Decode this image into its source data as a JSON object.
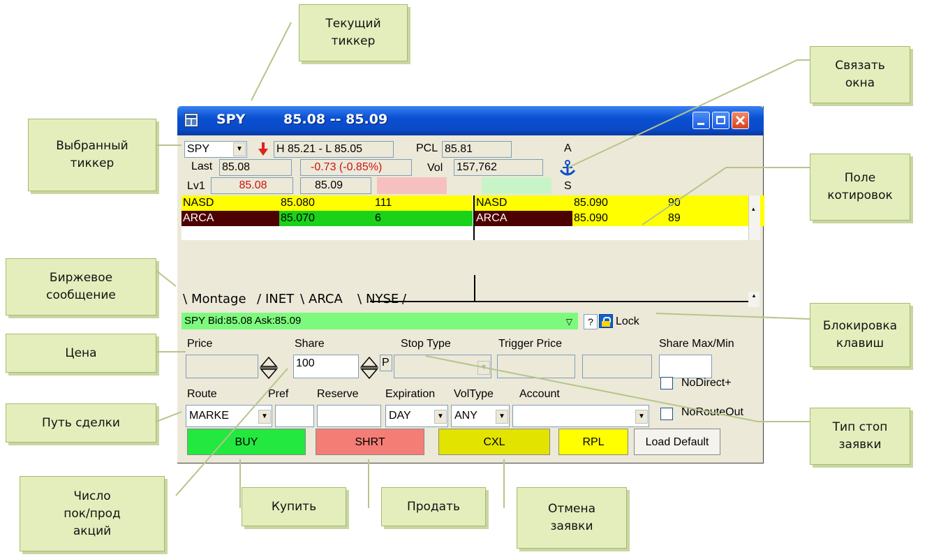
{
  "window": {
    "ticker": "SPY",
    "quote": "85.08 -- 85.09",
    "colors": {
      "title_blue": "#0a50d2",
      "close_red": "#e0421e"
    }
  },
  "header": {
    "symbol_select": "SPY",
    "down_arrow_icon": "down-arrow-icon",
    "high_low": "H 85.21 - L 85.05",
    "pcl_label": "PCL",
    "pcl_value": "85.81",
    "a_label": "A",
    "s_label": "S",
    "last_label": "Last",
    "last_value": "85.08",
    "change": "-0.73  (-0.85%)",
    "vol_label": "Vol",
    "vol_value": "157,762",
    "lv1_label": "Lv1",
    "lv1_bid": "85.08",
    "lv1_ask": "85.09"
  },
  "level2": {
    "bids": [
      {
        "mm": "NASD",
        "price": "85.080",
        "size": "111"
      },
      {
        "mm": "ARCA",
        "price": "85.070",
        "size": "6"
      }
    ],
    "asks": [
      {
        "mm": "NASD",
        "price": "85.090",
        "size": "90"
      },
      {
        "mm": "ARCA",
        "price": "85.090",
        "size": "89"
      }
    ]
  },
  "tabs": [
    "Montage",
    "INET",
    "ARCA",
    "NYSE"
  ],
  "message": {
    "text": "SPY Bid:85.08 Ask:85.09",
    "help": "?",
    "lock": "Lock"
  },
  "order": {
    "price_label": "Price",
    "share_label": "Share",
    "share_value": "100",
    "p_label": "P",
    "stop_type_label": "Stop Type",
    "trigger_price_label": "Trigger Price",
    "share_maxmin_label": "Share Max/Min",
    "route_label": "Route",
    "route_value": "MARKE",
    "pref_label": "Pref",
    "reserve_label": "Reserve",
    "expiration_label": "Expiration",
    "expiration_value": "DAY",
    "voltype_label": "VolType",
    "voltype_value": "ANY",
    "account_label": "Account",
    "nodirect_label": "NoDirect+",
    "norouteout_label": "NoRouteOut"
  },
  "buttons": {
    "buy": "BUY",
    "shrt": "SHRT",
    "cxl": "CXL",
    "rpl": "RPL",
    "load_default": "Load Default"
  },
  "callouts": {
    "current_ticker": "Текущий\nтиккер",
    "link_windows": "Связать\nокна",
    "selected_ticker": "Выбранный\nтиккер",
    "quote_field": "Поле\nкотировок",
    "exchange_message": "Биржевое\nсообщение",
    "key_lock": "Блокировка\nклавиш",
    "price": "Цена",
    "route": "Путь сделки",
    "stop_type": "Тип стоп\nзаявки",
    "shares_count": "Число\nпок/прод\nакций",
    "buy": "Купить",
    "sell": "Продать",
    "cancel": "Отмена\nзаявки"
  },
  "colors": {
    "callout_bg": "#e3eebc",
    "nasd_row": "#ffff00",
    "arca_bid_mm": "#4d0000",
    "arca_bid_green": "#19d219",
    "buy": "#22e83f",
    "shrt": "#f47e76",
    "cxl": "#e3e300",
    "rpl": "#ffff00"
  }
}
